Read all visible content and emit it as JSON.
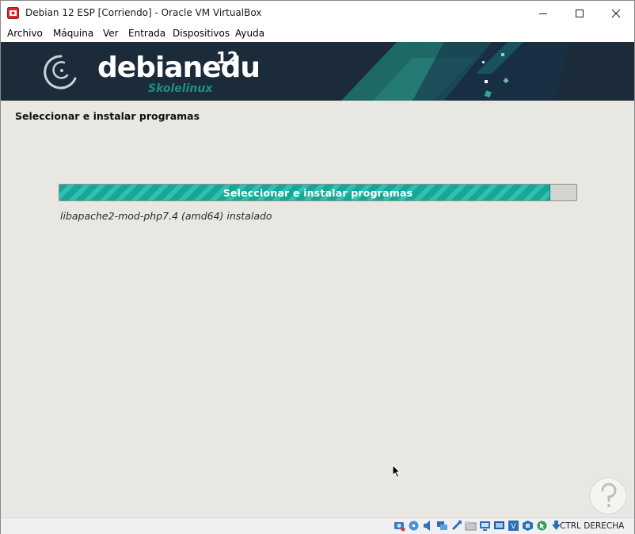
{
  "window": {
    "title": "Debian 12 ESP [Corriendo] - Oracle VM VirtualBox",
    "controls": {
      "minimize_icon": "minimize-icon",
      "maximize_icon": "maximize-icon",
      "close_icon": "close-icon"
    }
  },
  "menubar": {
    "items": [
      "Archivo",
      "Máquina",
      "Ver",
      "Entrada",
      "Dispositivos",
      "Ayuda"
    ]
  },
  "banner": {
    "brand_main": "debianedu",
    "brand_sub": "Skolelinux",
    "version": "12"
  },
  "installer": {
    "step_title": "Seleccionar e instalar programas",
    "progress_label": "Seleccionar e instalar programas",
    "progress_fraction": 0.95,
    "progress_detail": "libapache2-mod-php7.4 (amd64) instalado"
  },
  "statusbar": {
    "icons": [
      "hard-disk-icon",
      "optical-drive-icon",
      "audio-icon",
      "network-icon",
      "usb-icon",
      "shared-folders-icon",
      "display-icon",
      "screen-icon",
      "recording-icon",
      "virtualization-icon",
      "mouse-integration-icon",
      "keyboard-icon"
    ],
    "host_key": "CTRL DERECHA"
  },
  "colors": {
    "banner_bg": "#1b2b3a",
    "banner_accent": "#1f6f6a",
    "progress_fill": "#1aa596",
    "content_bg": "#e8e7e1"
  }
}
